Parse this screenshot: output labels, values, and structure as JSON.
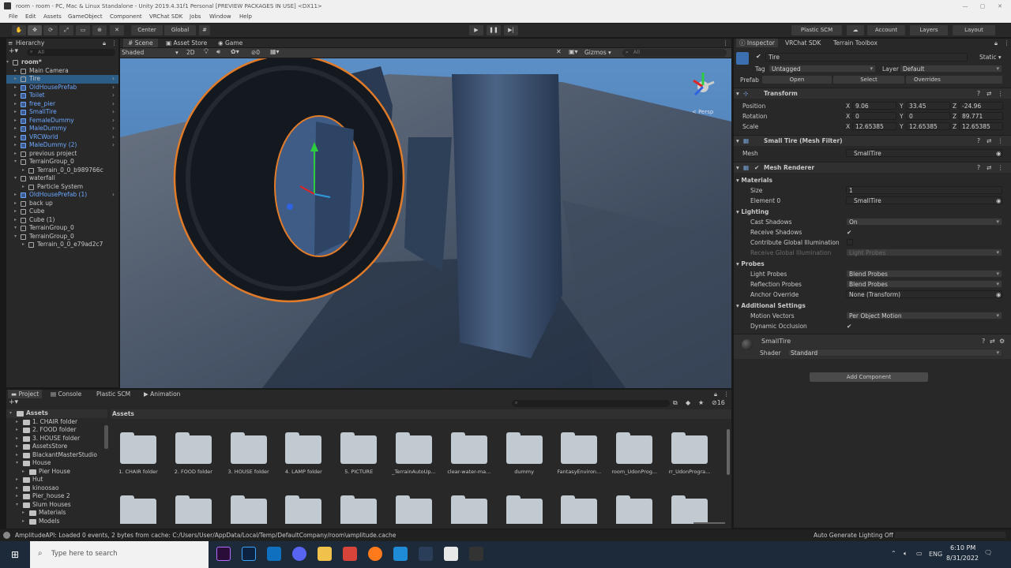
{
  "window": {
    "title": "room - room - PC, Mac & Linux Standalone - Unity 2019.4.31f1 Personal [PREVIEW PACKAGES IN USE] <DX11>",
    "minimize": "—",
    "maximize": "▢",
    "close": "✕"
  },
  "menu": [
    "File",
    "Edit",
    "Assets",
    "GameObject",
    "Component",
    "VRChat SDK",
    "Jobs",
    "Window",
    "Help"
  ],
  "toolbar": {
    "center": "Center",
    "global": "Global",
    "plastic_scm": "Plastic SCM",
    "account": "Account",
    "layers": "Layers",
    "layout": "Layout"
  },
  "hierarchy": {
    "tab": "Hierarchy",
    "search_placeholder": "All",
    "rows": [
      {
        "label": "room*",
        "depth": 0,
        "kind": "scene"
      },
      {
        "label": "Main Camera",
        "depth": 1,
        "kind": "obj"
      },
      {
        "label": "Tire",
        "depth": 1,
        "kind": "obj",
        "selected": true
      },
      {
        "label": "OldHousePrefab",
        "depth": 1,
        "kind": "prefab"
      },
      {
        "label": "Toilet",
        "depth": 1,
        "kind": "prefab"
      },
      {
        "label": "free_pier",
        "depth": 1,
        "kind": "prefab"
      },
      {
        "label": "SmallTire",
        "depth": 1,
        "kind": "prefab"
      },
      {
        "label": "FemaleDummy",
        "depth": 1,
        "kind": "prefab"
      },
      {
        "label": "MaleDummy",
        "depth": 1,
        "kind": "prefab"
      },
      {
        "label": "VRCWorld",
        "depth": 1,
        "kind": "prefab"
      },
      {
        "label": "MaleDummy (2)",
        "depth": 1,
        "kind": "prefab"
      },
      {
        "label": "previous project",
        "depth": 1,
        "kind": "obj"
      },
      {
        "label": "TerrainGroup_0",
        "depth": 1,
        "kind": "obj"
      },
      {
        "label": "Terrain_0_0_b989766c",
        "depth": 2,
        "kind": "obj"
      },
      {
        "label": "waterfall",
        "depth": 1,
        "kind": "obj"
      },
      {
        "label": "Particle System",
        "depth": 2,
        "kind": "obj"
      },
      {
        "label": "OldHousePrefab (1)",
        "depth": 1,
        "kind": "prefab"
      },
      {
        "label": "back up",
        "depth": 1,
        "kind": "obj"
      },
      {
        "label": "Cube",
        "depth": 1,
        "kind": "obj"
      },
      {
        "label": "Cube (1)",
        "depth": 1,
        "kind": "obj"
      },
      {
        "label": "TerrainGroup_0",
        "depth": 1,
        "kind": "obj"
      },
      {
        "label": "TerrainGroup_0",
        "depth": 1,
        "kind": "obj"
      },
      {
        "label": "Terrain_0_0_e79ad2c7",
        "depth": 2,
        "kind": "obj"
      }
    ]
  },
  "scene": {
    "tabs": [
      "Scene",
      "Asset Store",
      "Game"
    ],
    "shading": "Shaded",
    "mode_2d": "2D",
    "gizmos": "Gizmos",
    "search_placeholder": "All",
    "hidden_count": "0",
    "persp": "< Persp"
  },
  "inspector": {
    "tabs": [
      "Inspector",
      "VRChat SDK",
      "Terrain Toolbox"
    ],
    "object_name": "Tire",
    "static_label": "Static",
    "tag_label": "Tag",
    "tag_value": "Untagged",
    "layer_label": "Layer",
    "layer_value": "Default",
    "prefab_label": "Prefab",
    "prefab_open": "Open",
    "prefab_select": "Select",
    "prefab_overrides": "Overrides",
    "transform": {
      "title": "Transform",
      "position_label": "Position",
      "rotation_label": "Rotation",
      "scale_label": "Scale",
      "position": [
        "9.06",
        "33.45",
        "-24.96"
      ],
      "rotation": [
        "0",
        "0",
        "89.771"
      ],
      "scale": [
        "12.65385",
        "12.65385",
        "12.65385"
      ]
    },
    "mesh_filter": {
      "title": "Small Tire (Mesh Filter)",
      "mesh_label": "Mesh",
      "mesh_value": "SmallTire"
    },
    "mesh_renderer": {
      "title": "Mesh Renderer",
      "materials_label": "Materials",
      "size_label": "Size",
      "size_value": "1",
      "element0_label": "Element 0",
      "element0_value": "SmallTire",
      "lighting_label": "Lighting",
      "cast_shadows_label": "Cast Shadows",
      "cast_shadows_value": "On",
      "receive_shadows_label": "Receive Shadows",
      "contribute_gi_label": "Contribute Global Illumination",
      "receive_gi_label": "Receive Global Illumination",
      "receive_gi_value": "Light Probes",
      "probes_label": "Probes",
      "light_probes_label": "Light Probes",
      "light_probes_value": "Blend Probes",
      "reflection_probes_label": "Reflection Probes",
      "reflection_probes_value": "Blend Probes",
      "anchor_override_label": "Anchor Override",
      "anchor_override_value": "None (Transform)",
      "additional_label": "Additional Settings",
      "motion_vectors_label": "Motion Vectors",
      "motion_vectors_value": "Per Object Motion",
      "dynamic_occlusion_label": "Dynamic Occlusion"
    },
    "material": {
      "name": "SmallTire",
      "shader_label": "Shader",
      "shader_value": "Standard"
    },
    "add_component": "Add Component"
  },
  "project": {
    "tabs": [
      "Project",
      "Console",
      "Plastic SCM",
      "Animation"
    ],
    "breadcrumb": "Assets",
    "hidden_count": "16",
    "tree": [
      {
        "label": "Assets",
        "depth": 0,
        "open": true
      },
      {
        "label": "1. CHAIR folder",
        "depth": 1
      },
      {
        "label": "2. FOOD folder",
        "depth": 1
      },
      {
        "label": "3. HOUSE folder",
        "depth": 1
      },
      {
        "label": "AssetsStore",
        "depth": 1
      },
      {
        "label": "BlackantMasterStudio",
        "depth": 1
      },
      {
        "label": "House",
        "depth": 1,
        "open": true
      },
      {
        "label": "Pier House",
        "depth": 2
      },
      {
        "label": "Hut",
        "depth": 1
      },
      {
        "label": "kinoosao",
        "depth": 1
      },
      {
        "label": "Pier_house 2",
        "depth": 1
      },
      {
        "label": "Slum Houses",
        "depth": 1,
        "open": true
      },
      {
        "label": "Materials",
        "depth": 2
      },
      {
        "label": "Models",
        "depth": 2
      }
    ],
    "folders": [
      "1. CHAIR folder",
      "2. FOOD folder",
      "3. HOUSE folder",
      "4. LAMP folder",
      "5. PICTURE",
      "_TerrainAutoUp...",
      "clear-water-ma...",
      "dummy",
      "FantasyEnviron...",
      "room_UdonProg...",
      "rr_UdonProgra..."
    ]
  },
  "status": {
    "message": "AmplitudeAPI: Loaded 0 events, 2 bytes from cache: C:/Users/User/AppData/Local/Temp/DefaultCompany/room\\amplitude.cache",
    "lighting": "Auto Generate Lighting Off"
  },
  "taskbar": {
    "search_placeholder": "Type here to search",
    "language": "ENG",
    "time": "6:10 PM",
    "date": "8/31/2022"
  }
}
